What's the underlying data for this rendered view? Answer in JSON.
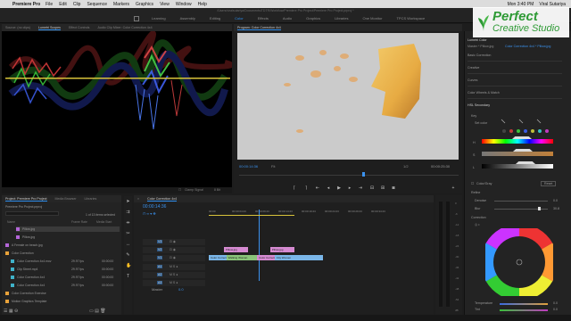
{
  "menubar": {
    "app_name": "Premiere Pro",
    "items": [
      "File",
      "Edit",
      "Clip",
      "Sequence",
      "Markers",
      "Graphics",
      "View",
      "Window",
      "Help"
    ],
    "clock": "Mon 3:40 PM",
    "user": "Viral Sutariya"
  },
  "window": {
    "path": "/Users/viralsutariya/Documents/TDTR/Workflow/Premiere Pro Project/Premiere Pro Project.prproj *"
  },
  "workspaces": [
    "Learning",
    "Assembly",
    "Editing",
    "Color",
    "Effects",
    "Audio",
    "Graphics",
    "Libraries",
    "One Monitor",
    "TPCS Workspace"
  ],
  "workspace_active": "Color",
  "brand": {
    "line1": "Perfect",
    "line2": "Creative Studio"
  },
  "source_tabs": [
    "Source: (no clips)",
    "Lumetri Scopes",
    "Effect Controls",
    "Audio Clip Mixer: Color Correction 4x4"
  ],
  "source_active": 1,
  "scope": {
    "clamp_label": "Clamp Signal",
    "bit_label": "8 Bit"
  },
  "program": {
    "title": "Program: Color Correction 4x4",
    "timecode_current": "00:00:14:36",
    "fit": "Fit",
    "quality": "1/2",
    "timecode_duration": "00:00:25:30"
  },
  "lumetri": {
    "tab": "Lumetri Color",
    "master": "Master * Pillow.jpg",
    "sequence": "Color Correction 4x4 * Pillow.jpg",
    "sections": [
      "Basic Correction",
      "Creative",
      "Curves",
      "Color Wheels & Match",
      "HSL Secondary"
    ],
    "key": "Key",
    "set_color": "Set color",
    "h": "H",
    "s": "S",
    "l": "L",
    "color_gray": "Color/Gray",
    "reset": "Reset",
    "refine": "Refine",
    "denoise_label": "Denoise",
    "denoise_value": "0.0",
    "blur_label": "Blur",
    "blur_value": "30.8",
    "correction": "Correction",
    "temperature_label": "Temperature",
    "temperature_value": "0.0",
    "tint_label": "Tint",
    "tint_value": "0.0"
  },
  "project": {
    "tabs": [
      "Project: Premiere Pro Project",
      "Media Browser",
      "Libraries",
      "Info"
    ],
    "file_name": "Premiere Pro Project.prproj",
    "search_placeholder": "",
    "selection_info": "1 of 13 items selected",
    "col_name": "Name",
    "col_frame_rate": "Frame Rate",
    "col_media_start": "Media Start",
    "items": [
      {
        "name": "Pillow.jpg",
        "rate": "",
        "start": "",
        "color": "#b466d8",
        "indent": 2,
        "selected": true
      },
      {
        "name": "Pillow.jpg",
        "rate": "",
        "start": "",
        "color": "#b466d8",
        "indent": 2,
        "selected": false
      },
      {
        "name": "A Female on beach.jpg",
        "rate": "",
        "start": "",
        "color": "#b466d8",
        "indent": 0,
        "selected": false
      },
      {
        "name": "Color Correction",
        "rate": "",
        "start": "",
        "color": "#e8a23a",
        "indent": 0,
        "selected": false
      },
      {
        "name": "Color Correction 4x4.mov",
        "rate": "29.97 fps",
        "start": "00:00:00",
        "color": "#3fb2c9",
        "indent": 1,
        "selected": false
      },
      {
        "name": "Clip Street.mp4",
        "rate": "29.97 fps",
        "start": "00:00:00",
        "color": "#3fb2c9",
        "indent": 1,
        "selected": false
      },
      {
        "name": "Color Correction 4x4",
        "rate": "29.97 fps",
        "start": "00:00:00",
        "color": "#3fb2c9",
        "indent": 1,
        "selected": false
      },
      {
        "name": "Color Correction 4x4",
        "rate": "29.97 fps",
        "start": "00:00:00",
        "color": "#3fb2c9",
        "indent": 1,
        "selected": false
      },
      {
        "name": "Color Correction Exercise",
        "rate": "",
        "start": "",
        "color": "#e8a23a",
        "indent": 0,
        "selected": false
      },
      {
        "name": "Motion Graphics Template",
        "rate": "",
        "start": "",
        "color": "#e8a23a",
        "indent": 0,
        "selected": false
      }
    ]
  },
  "timeline": {
    "tab": "Color Correction 4x4",
    "timecode": "00:00:14:36",
    "ruler": [
      "00:00",
      "00:00:04:23",
      "00:00:09:23",
      "00:00:14:23",
      "00:00:19:23",
      "00:00:24:23",
      "00:00:29:23",
      "00:00:34:23"
    ],
    "tracks": [
      "V3",
      "V2",
      "V1",
      "A1",
      "A2",
      "A3",
      "Master"
    ],
    "master_value": "0.0",
    "clips": [
      {
        "label": "Pillow.jpg",
        "track": 1,
        "kind": "pink",
        "start": 0.07,
        "end": 0.18
      },
      {
        "label": "Pillow.jpg",
        "track": 1,
        "kind": "pink",
        "start": 0.28,
        "end": 0.39
      },
      {
        "label": "Color Correction",
        "track": 2,
        "kind": "blue",
        "start": 0.0,
        "end": 0.08
      },
      {
        "label": "Walking Woman",
        "track": 2,
        "kind": "green",
        "start": 0.08,
        "end": 0.22
      },
      {
        "label": "Color Correction",
        "track": 2,
        "kind": "pink",
        "start": 0.22,
        "end": 0.3
      },
      {
        "label": "City Women",
        "track": 2,
        "kind": "blue",
        "start": 0.3,
        "end": 0.52
      }
    ]
  },
  "audio_meter": {
    "labels": [
      "0",
      "-6",
      "-12",
      "-18",
      "-24",
      "-30",
      "-36",
      "-42",
      "-48",
      "-54"
    ],
    "bottom": "dB"
  }
}
